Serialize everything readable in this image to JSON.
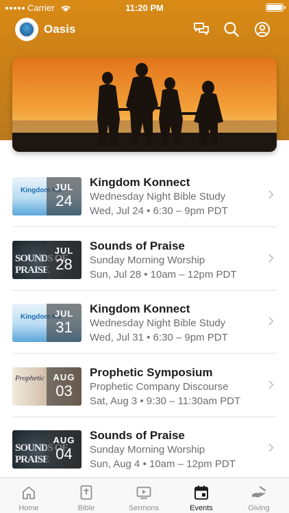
{
  "status_bar": {
    "carrier": "Carrier",
    "time": "11:20 PM"
  },
  "app": {
    "name": "Oasis"
  },
  "header_icons": [
    "chat-icon",
    "search-icon",
    "profile-icon"
  ],
  "colors": {
    "accent": "#d98a16",
    "title": "#1c1c1e",
    "secondary": "#6d6d72"
  },
  "events": [
    {
      "title": "Kingdom Konnect",
      "subtitle": "Wednesday Night Bible Study",
      "when": "Wed, Jul 24 • 6:30 – 9pm PDT",
      "month": "JUL",
      "day": "24",
      "thumb": "kingdom",
      "thumb_text": "Kingdom Ko"
    },
    {
      "title": "Sounds of Praise",
      "subtitle": "Sunday Morning Worship",
      "when": "Sun, Jul 28 • 10am – 12pm PDT",
      "month": "JUL",
      "day": "28",
      "thumb": "praise",
      "thumb_text": "SOUNDS OF PRAISE"
    },
    {
      "title": "Kingdom Konnect",
      "subtitle": "Wednesday Night Bible Study",
      "when": "Wed, Jul 31 • 6:30 – 9pm PDT",
      "month": "JUL",
      "day": "31",
      "thumb": "kingdom",
      "thumb_text": "Kingdom Ko"
    },
    {
      "title": "Prophetic Symposium",
      "subtitle": "Prophetic Company Discourse",
      "when": "Sat, Aug 3 • 9:30 – 11:30am PDT",
      "month": "AUG",
      "day": "03",
      "thumb": "prophetic",
      "thumb_text": "Prophetic"
    },
    {
      "title": "Sounds of Praise",
      "subtitle": "Sunday Morning Worship",
      "when": "Sun, Aug 4 • 10am – 12pm PDT",
      "month": "AUG",
      "day": "04",
      "thumb": "praise",
      "thumb_text": "SOUNDS OF PRAISE"
    }
  ],
  "tabs": [
    {
      "label": "Home",
      "icon": "home-icon",
      "active": false
    },
    {
      "label": "Bible",
      "icon": "bible-icon",
      "active": false
    },
    {
      "label": "Sermons",
      "icon": "sermons-icon",
      "active": false
    },
    {
      "label": "Events",
      "icon": "events-icon",
      "active": true
    },
    {
      "label": "Giving",
      "icon": "giving-icon",
      "active": false
    }
  ]
}
